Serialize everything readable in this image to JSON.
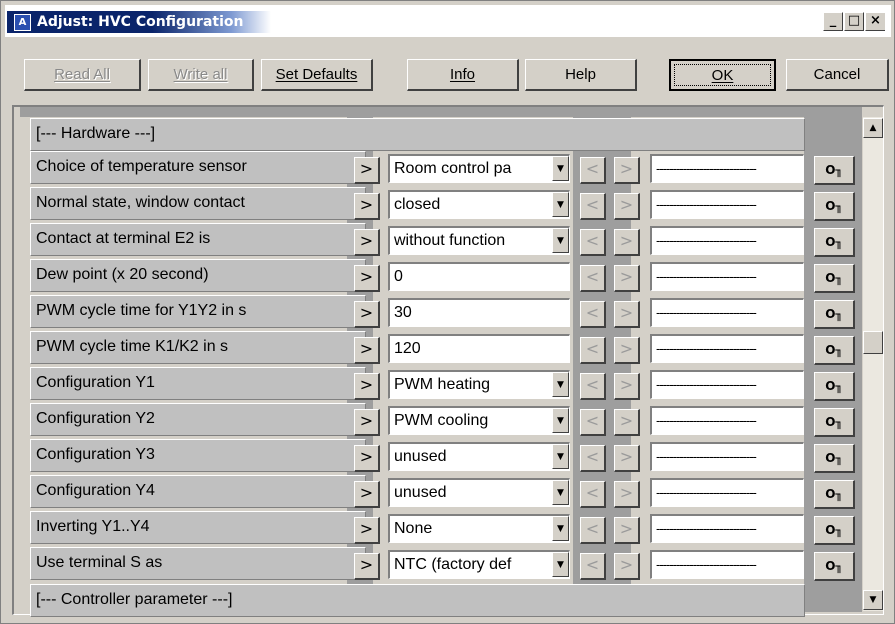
{
  "window": {
    "title": "Adjust: HVC Configuration",
    "minimize": "_",
    "maximize": "□",
    "close": "×"
  },
  "toolbar": {
    "read_all": "Read All",
    "write_all": "Write all",
    "set_defaults": "Set Defaults",
    "info": "Info",
    "help": "Help",
    "ok": "OK",
    "cancel": "Cancel"
  },
  "grid": {
    "section_hardware": "[--- Hardware ---]",
    "section_controller": "[--- Controller parameter ---]",
    "dashes": "------------------------------",
    "key_symbol": "O╖",
    "rows": [
      {
        "label": "Choice of temperature sensor",
        "value": "Room control pa",
        "type": "dropdown"
      },
      {
        "label": "Normal state, window contact",
        "value": "closed",
        "type": "dropdown"
      },
      {
        "label": "Contact at terminal E2 is",
        "value": "without function",
        "type": "dropdown"
      },
      {
        "label": "Dew point (x 20 second)",
        "value": "0",
        "type": "text"
      },
      {
        "label": "PWM cycle time for Y1Y2 in s",
        "value": "30",
        "type": "text"
      },
      {
        "label": "PWM cycle time K1/K2 in s",
        "value": "120",
        "type": "text"
      },
      {
        "label": "Configuration Y1",
        "value": "PWM heating",
        "type": "dropdown"
      },
      {
        "label": "Configuration Y2",
        "value": "PWM cooling",
        "type": "dropdown"
      },
      {
        "label": "Configuration Y3",
        "value": "unused",
        "type": "dropdown"
      },
      {
        "label": "Configuration Y4",
        "value": "unused",
        "type": "dropdown"
      },
      {
        "label": "Inverting Y1..Y4",
        "value": "None",
        "type": "dropdown"
      },
      {
        "label": "Use terminal S as",
        "value": "NTC (factory def",
        "type": "dropdown"
      }
    ]
  }
}
